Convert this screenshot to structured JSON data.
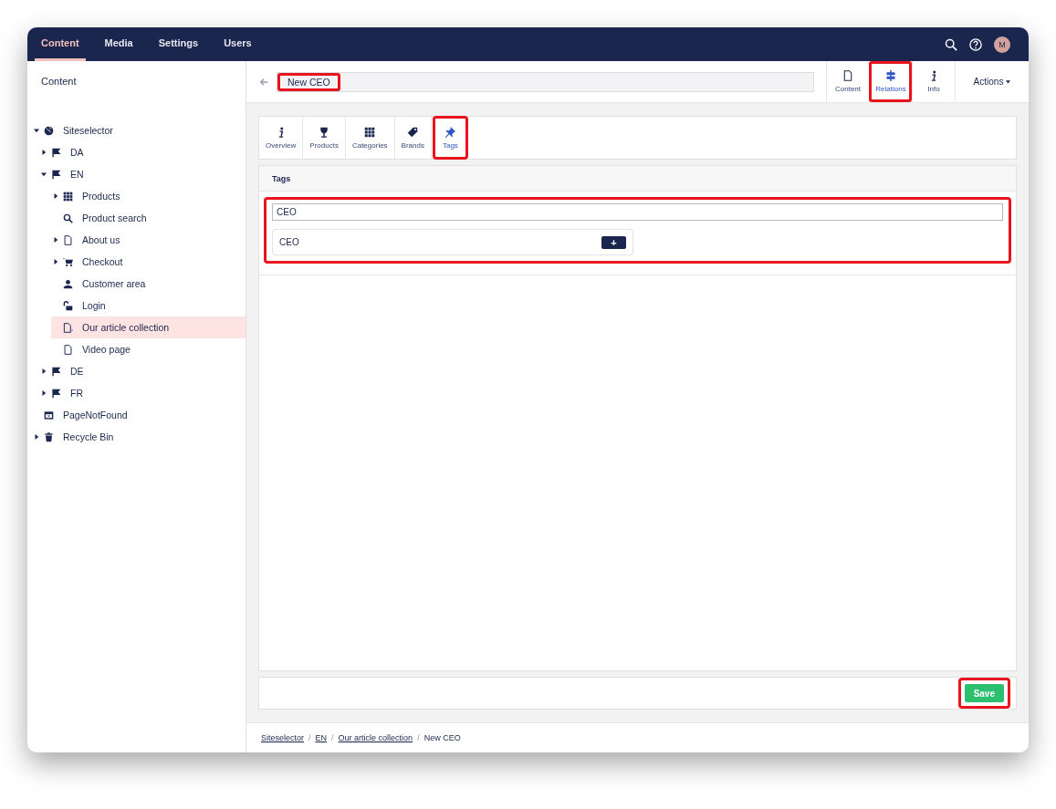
{
  "top_nav": {
    "sections": [
      {
        "label": "Content",
        "selected": true
      },
      {
        "label": "Media",
        "selected": false
      },
      {
        "label": "Settings",
        "selected": false
      },
      {
        "label": "Users",
        "selected": false
      }
    ],
    "avatar": "M"
  },
  "sidebar": {
    "title": "Content",
    "tree": [
      {
        "label": "Siteselector",
        "kind": "globe",
        "expanded": true,
        "selected": false,
        "children": [
          {
            "label": "DA",
            "kind": "flag",
            "expanded": false,
            "selected": false
          },
          {
            "label": "EN",
            "kind": "flag",
            "expanded": true,
            "selected": false,
            "children": [
              {
                "label": "Products",
                "kind": "grid",
                "expanded": false,
                "selected": false
              },
              {
                "label": "Product search",
                "kind": "search",
                "selected": false
              },
              {
                "label": "About us",
                "kind": "page",
                "expanded": false,
                "selected": false
              },
              {
                "label": "Checkout",
                "kind": "cart",
                "expanded": false,
                "selected": false
              },
              {
                "label": "Customer area",
                "kind": "user",
                "selected": false
              },
              {
                "label": "Login",
                "kind": "lock",
                "selected": false
              },
              {
                "label": "Our article collection",
                "kind": "list",
                "selected": true
              },
              {
                "label": "Video page",
                "kind": "page",
                "selected": false
              }
            ]
          },
          {
            "label": "DE",
            "kind": "flag",
            "expanded": false,
            "selected": false
          },
          {
            "label": "FR",
            "kind": "flag",
            "expanded": false,
            "selected": false
          }
        ]
      },
      {
        "label": "PageNotFound",
        "kind": "window",
        "selected": false
      },
      {
        "label": "Recycle Bin",
        "kind": "trash",
        "expanded": false,
        "selected": false
      }
    ]
  },
  "header": {
    "name": {
      "value": "New CEO",
      "highlighted": true
    },
    "apps": [
      {
        "label": "Content",
        "kind": "page",
        "selected": false,
        "highlighted": false
      },
      {
        "label": "Relations",
        "kind": "signpost",
        "selected": true,
        "highlighted": true
      },
      {
        "label": "Info",
        "kind": "info",
        "selected": false,
        "highlighted": false
      }
    ],
    "actions": "Actions"
  },
  "relation_tabs": [
    {
      "label": "Overview",
      "kind": "info",
      "selected": false,
      "highlighted": false
    },
    {
      "label": "Products",
      "kind": "glass",
      "selected": false,
      "highlighted": false
    },
    {
      "label": "Categories",
      "kind": "grid",
      "selected": false,
      "highlighted": false
    },
    {
      "label": "Brands",
      "kind": "tag",
      "selected": false,
      "highlighted": false
    },
    {
      "label": "Tags",
      "kind": "pin",
      "selected": true,
      "highlighted": true
    }
  ],
  "tags_panel": {
    "title": "Tags",
    "search": {
      "value": "CEO"
    },
    "suggestions": [
      {
        "label": "CEO",
        "add": "+"
      }
    ],
    "highlighted": true
  },
  "save_button": {
    "label": "Save",
    "highlighted": true
  },
  "breadcrumb": [
    {
      "label": "Siteselector",
      "link": true
    },
    {
      "label": "EN",
      "link": true
    },
    {
      "label": "Our article collection",
      "link": true
    },
    {
      "label": "New CEO",
      "link": false
    }
  ],
  "breadcrumb_separator": "/"
}
